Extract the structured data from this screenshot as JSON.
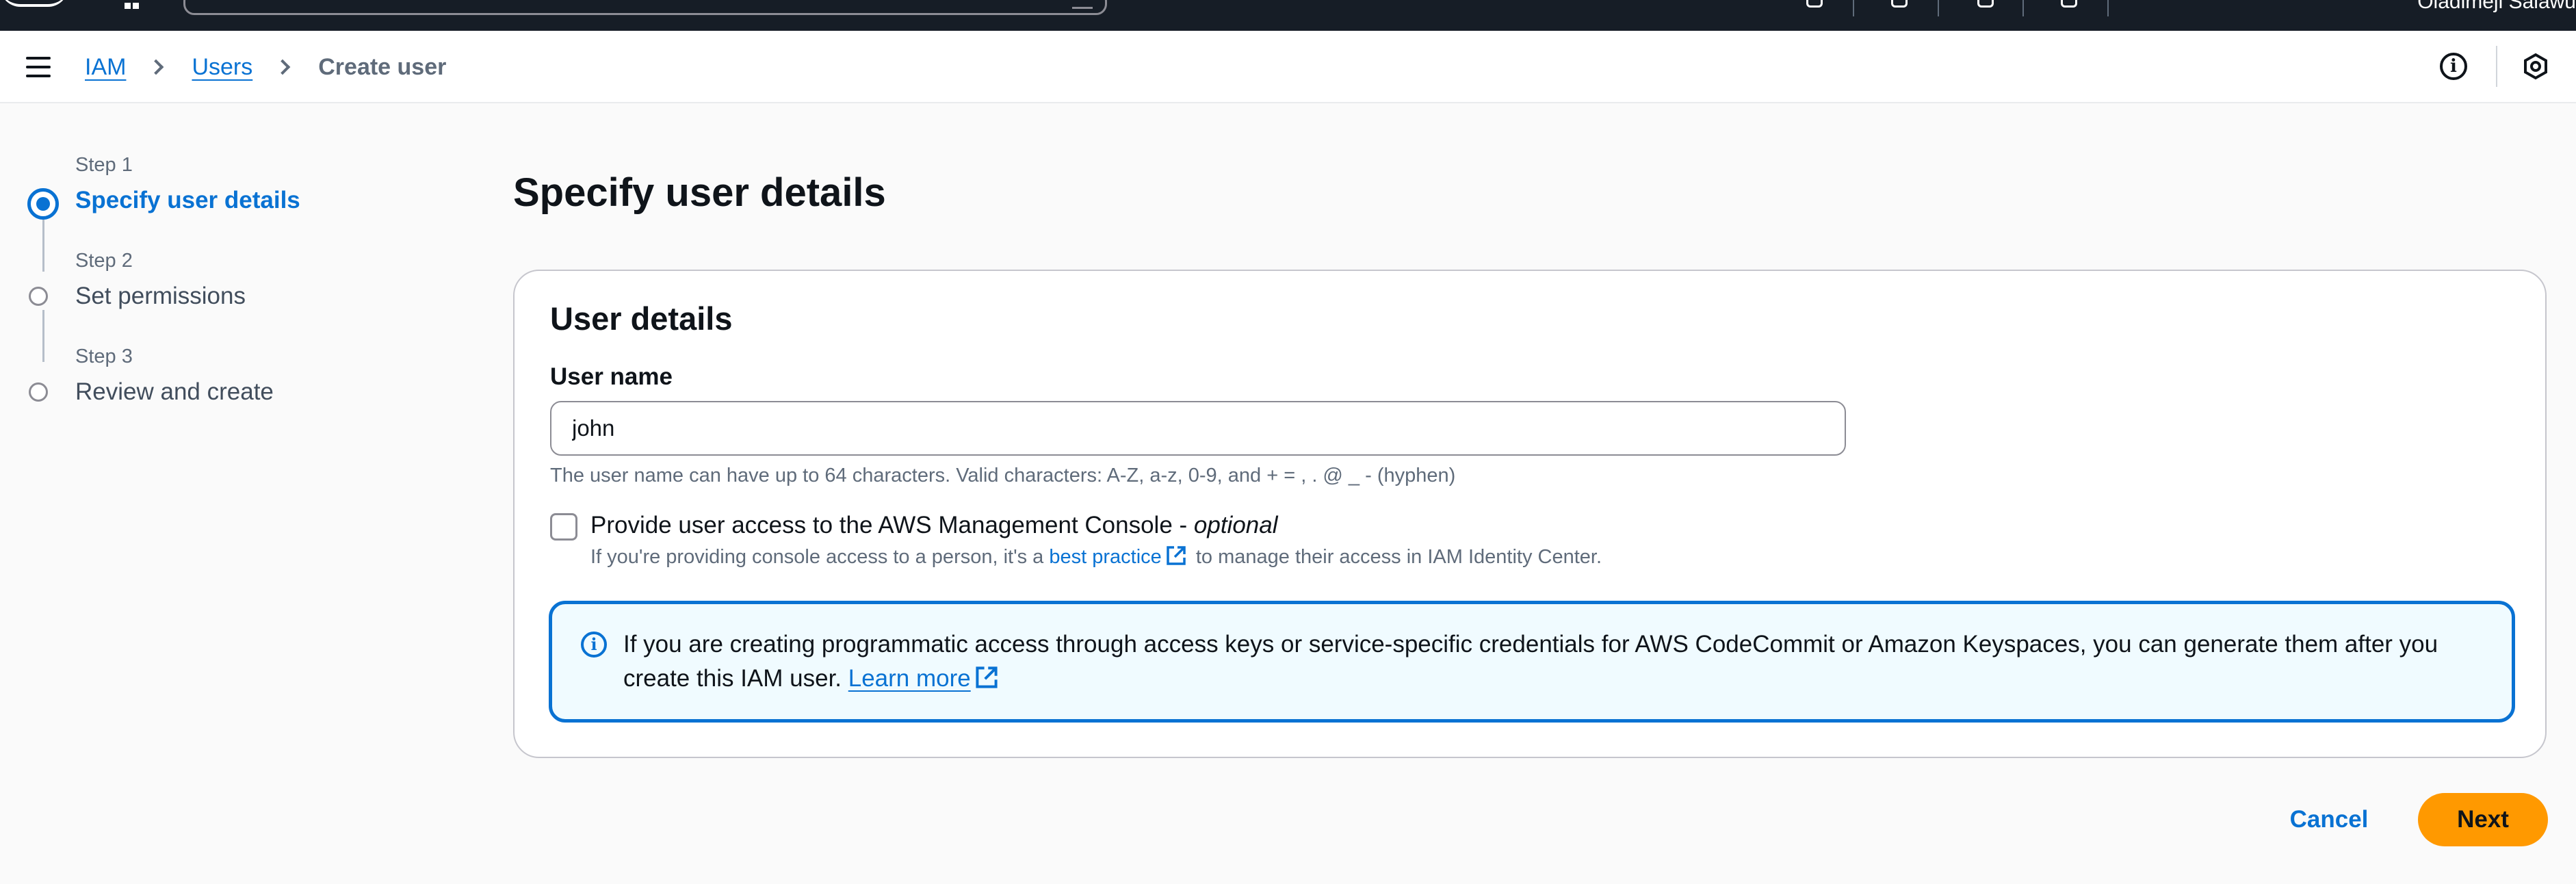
{
  "top_bar": {
    "user_name": "Oladimeji Salawu"
  },
  "breadcrumb": {
    "items": [
      {
        "label": "IAM"
      },
      {
        "label": "Users"
      },
      {
        "label": "Create user"
      }
    ]
  },
  "steps": [
    {
      "number": "Step 1",
      "title": "Specify user details",
      "active": true
    },
    {
      "number": "Step 2",
      "title": "Set permissions",
      "active": false
    },
    {
      "number": "Step 3",
      "title": "Review and create",
      "active": false
    }
  ],
  "main": {
    "page_title": "Specify user details",
    "card": {
      "title": "User details",
      "user_name_label": "User name",
      "user_name_value": "john",
      "user_name_constraint": "The user name can have up to 64 characters. Valid characters: A-Z, a-z, 0-9, and + = , . @ _ - (hyphen)",
      "console_access": {
        "label": "Provide user access to the AWS Management Console - ",
        "label_optional": "optional",
        "checked": false,
        "desc_before": "If you're providing console access to a person, it's a ",
        "desc_link": "best practice",
        "desc_after": " to manage their access in IAM Identity Center."
      },
      "info_alert": {
        "text": "If you are creating programmatic access through access keys or service-specific credentials for AWS CodeCommit or Amazon Keyspaces, you can generate them after you create this IAM user. ",
        "link": "Learn more"
      }
    }
  },
  "actions": {
    "cancel_label": "Cancel",
    "next_label": "Next"
  },
  "colors": {
    "accent": "#0972d3",
    "primary_button": "#ff9900",
    "top_bar": "#161d26"
  },
  "icons": [
    "menu-icon",
    "chevron-right-icon",
    "info-icon",
    "settings-hexagon-icon",
    "external-link-icon"
  ]
}
